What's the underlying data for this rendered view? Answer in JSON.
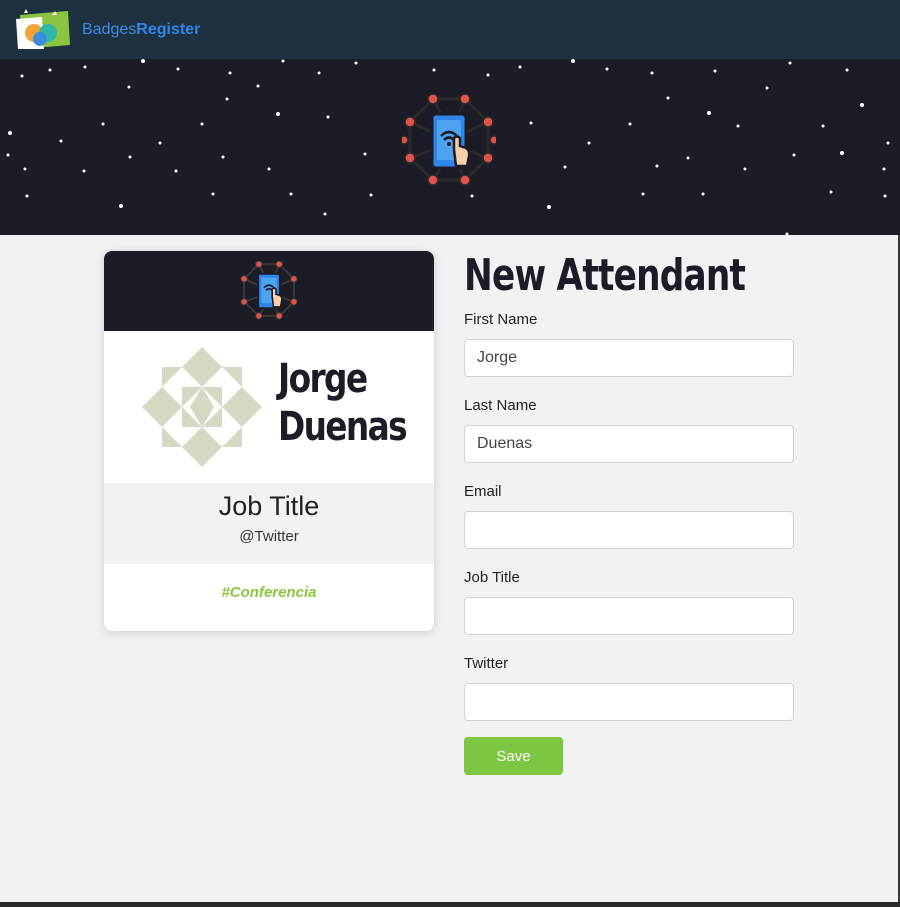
{
  "navbar": {
    "brand_light": "Badges",
    "brand_bold": "Register"
  },
  "badge": {
    "first_name": "Jorge",
    "last_name": "Duenas",
    "job_title": "Job Title",
    "twitter": "@Twitter",
    "hashtag": "#Conferencia"
  },
  "form": {
    "title": "New Attendant",
    "first_name_label": "First Name",
    "first_name_value": "Jorge",
    "last_name_label": "Last Name",
    "last_name_value": "Duenas",
    "email_label": "Email",
    "email_value": "",
    "job_title_label": "Job Title",
    "job_title_value": "",
    "twitter_label": "Twitter",
    "twitter_value": "",
    "save_label": "Save"
  },
  "colors": {
    "navbar": "#1e3141",
    "hero": "#1b1c26",
    "save": "#7cc644",
    "hashtag": "#8bc53f",
    "brand": "#2f86e8"
  },
  "icons": {
    "brand": "badges-register-logo-icon",
    "hero": "connected-phone-icon",
    "avatar": "identicon-avatar-icon"
  }
}
